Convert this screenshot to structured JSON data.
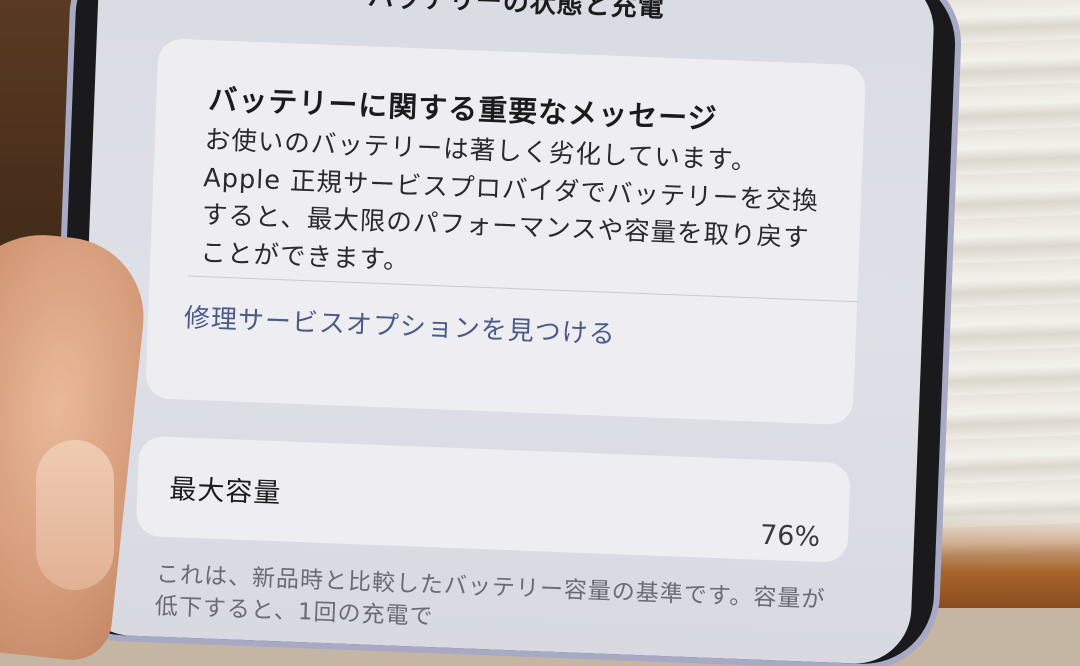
{
  "header": {
    "title": "バッテリーの状態と充電"
  },
  "message_card": {
    "title": "バッテリーに関する重要なメッセージ",
    "body_lines": [
      "お使いのバッテリーは著しく劣化しています。",
      "Apple 正規サービスプロバイダでバッテリーを交換",
      "すると、最大限のパフォーマンスや容量を取り戻す",
      "ことができます。"
    ],
    "link_label": "修理サービスオプションを見つける"
  },
  "capacity_card": {
    "label": "最大容量",
    "value": "76%"
  },
  "footnote": "これは、新品時と比較したバッテリー容量の基準です。容量が低下すると、1回の充電で"
}
